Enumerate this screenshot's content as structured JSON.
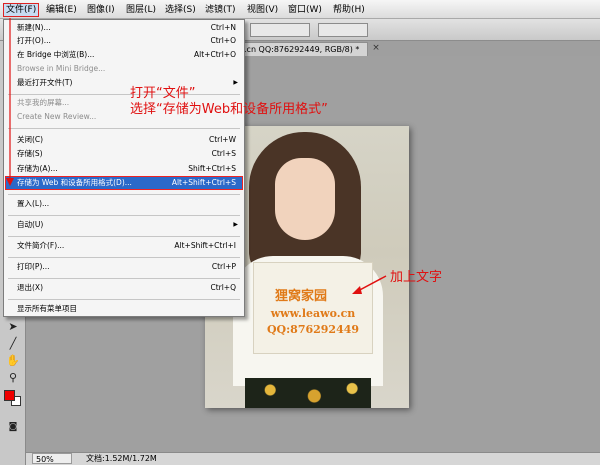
{
  "menubar": {
    "items": [
      {
        "label": "文件(F)",
        "active": true
      },
      {
        "label": "编辑(E)"
      },
      {
        "label": "图像(I)"
      },
      {
        "label": "图层(L)"
      },
      {
        "label": "选择(S)"
      },
      {
        "label": "滤镜(T)"
      },
      {
        "label": "视图(V)"
      },
      {
        "label": "窗口(W)"
      },
      {
        "label": "帮助(H)"
      }
    ]
  },
  "document_tab": {
    "title": ".cn QQ:876292449, RGB/8) *",
    "close_glyph": "×"
  },
  "file_menu": {
    "items": [
      {
        "label": "新建(N)...",
        "shortcut": "Ctrl+N"
      },
      {
        "label": "打开(O)...",
        "shortcut": "Ctrl+O"
      },
      {
        "label": "在 Bridge 中浏览(B)...",
        "shortcut": "Alt+Ctrl+O"
      },
      {
        "label": "Browse in Mini Bridge...",
        "shortcut": "",
        "disabled": true
      },
      {
        "label": "最近打开文件(T)",
        "shortcut": "",
        "submenu": true
      },
      {
        "label": "共享我的屏幕...",
        "shortcut": "",
        "disabled": true
      },
      {
        "label": "Create New Review...",
        "shortcut": "",
        "disabled": true
      },
      {
        "label": "关闭(C)",
        "shortcut": "Ctrl+W"
      },
      {
        "label": "存储(S)",
        "shortcut": "Ctrl+S"
      },
      {
        "label": "存储为(A)...",
        "shortcut": "Shift+Ctrl+S"
      },
      {
        "label": "存储为 Web 和设备所用格式(D)...",
        "shortcut": "Alt+Shift+Ctrl+S",
        "selected": true
      },
      {
        "label": "置入(L)...",
        "shortcut": ""
      },
      {
        "label": "自动(U)",
        "shortcut": "",
        "submenu": true
      },
      {
        "label": "文件简介(F)...",
        "shortcut": "Alt+Shift+Ctrl+I"
      },
      {
        "label": "打印(P)...",
        "shortcut": "Ctrl+P"
      },
      {
        "label": "退出(X)",
        "shortcut": "Ctrl+Q"
      },
      {
        "label": "显示所有菜单项目",
        "shortcut": ""
      }
    ]
  },
  "annotations": {
    "line1": "打开“文件”",
    "line2": "选择“存储为Web和设备所用格式”",
    "add_text": "加上文字",
    "color": "#e01010"
  },
  "photo": {
    "sign_line1": "狸窝家园",
    "sign_line2": "www.leawo.cn",
    "sign_line3": "QQ:876292449",
    "sign_color": "#e07a18"
  },
  "status": {
    "zoom": "50%",
    "doc_info": "文档:1.52M/1.72M"
  },
  "tools": {
    "icons": [
      "marquee-tool-icon",
      "pen-tool-icon",
      "hand-tool-icon",
      "zoom-tool-icon"
    ],
    "foreground_color": "#ee0000",
    "background_color": "#ffffff"
  }
}
